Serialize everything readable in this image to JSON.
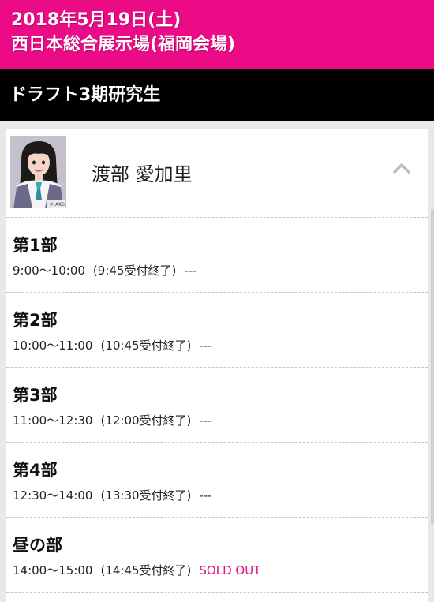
{
  "header": {
    "date": "2018年5月19日(土)",
    "venue": "西日本総合展示場(福岡会場)"
  },
  "subheader": {
    "title": "ドラフト3期研究生"
  },
  "member": {
    "name": "渡部 愛加里",
    "photo_credit": "© AKS",
    "toggle_icon": "chevron-up-icon"
  },
  "sessions": [
    {
      "title": "第1部",
      "time": "9:00〜10:00",
      "deadline": "(9:45受付終了)",
      "status": "---"
    },
    {
      "title": "第2部",
      "time": "10:00〜11:00",
      "deadline": "(10:45受付終了)",
      "status": "---"
    },
    {
      "title": "第3部",
      "time": "11:00〜12:30",
      "deadline": "(12:00受付終了)",
      "status": "---"
    },
    {
      "title": "第4部",
      "time": "12:30〜14:00",
      "deadline": "(13:30受付終了)",
      "status": "---"
    },
    {
      "title": "昼の部",
      "time": "14:00〜15:00",
      "deadline": "(14:45受付終了)",
      "status": "SOLD OUT"
    }
  ],
  "colors": {
    "header_bg": "#ec0b86",
    "subheader_bg": "#000000",
    "soldout": "#e0117f"
  }
}
